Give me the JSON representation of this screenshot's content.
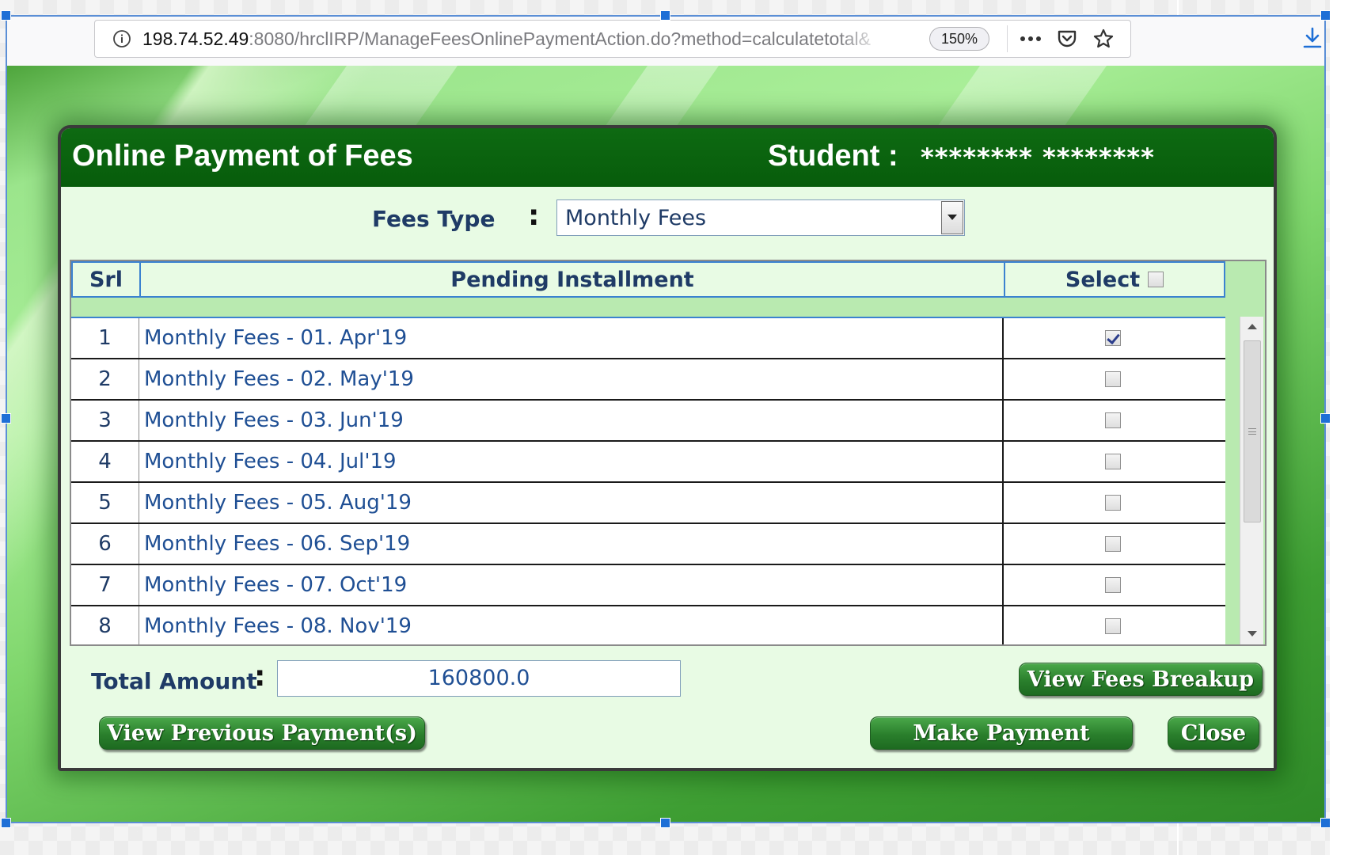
{
  "browser": {
    "url_host": "198.74.52.49",
    "url_path": ":8080/hrclIRP/ManageFeesOnlinePaymentAction.do?method=calculatetotal&",
    "zoom": "150%"
  },
  "dialog": {
    "title": "Online Payment of Fees",
    "student_label": "Student :",
    "student_name": "******** ********",
    "fees_type_label": "Fees Type",
    "fees_type_colon": ":",
    "fees_type_value": "Monthly Fees",
    "table": {
      "headers": {
        "srl": "Srl",
        "installment": "Pending Installment",
        "select": "Select"
      },
      "select_all_checked": false,
      "rows": [
        {
          "srl": "1",
          "installment": "Monthly Fees - 01. Apr'19",
          "checked": true
        },
        {
          "srl": "2",
          "installment": "Monthly Fees - 02. May'19",
          "checked": false
        },
        {
          "srl": "3",
          "installment": "Monthly Fees - 03. Jun'19",
          "checked": false
        },
        {
          "srl": "4",
          "installment": "Monthly Fees - 04. Jul'19",
          "checked": false
        },
        {
          "srl": "5",
          "installment": "Monthly Fees - 05. Aug'19",
          "checked": false
        },
        {
          "srl": "6",
          "installment": "Monthly Fees - 06. Sep'19",
          "checked": false
        },
        {
          "srl": "7",
          "installment": "Monthly Fees - 07. Oct'19",
          "checked": false
        },
        {
          "srl": "8",
          "installment": "Monthly Fees - 08. Nov'19",
          "checked": false
        }
      ]
    },
    "total_label": "Total Amount",
    "total_colon": ":",
    "total_value": "160800.0",
    "buttons": {
      "view_breakup": "View Fees Breakup",
      "view_previous": "View Previous Payment(s)",
      "make_payment": "Make Payment",
      "close": "Close"
    }
  },
  "colors": {
    "header_green": "#075c0b",
    "dialog_bg": "#e8fbe4",
    "label_navy": "#1f3b66",
    "row_text_blue": "#1f4f94",
    "button_green": "#2a7f2c"
  },
  "icons": {
    "site_info": "info-icon",
    "page_actions": "more-icon",
    "pocket": "pocket-icon",
    "bookmark": "star-icon",
    "downloads": "download-icon",
    "dropdown": "chevron-down-icon"
  }
}
